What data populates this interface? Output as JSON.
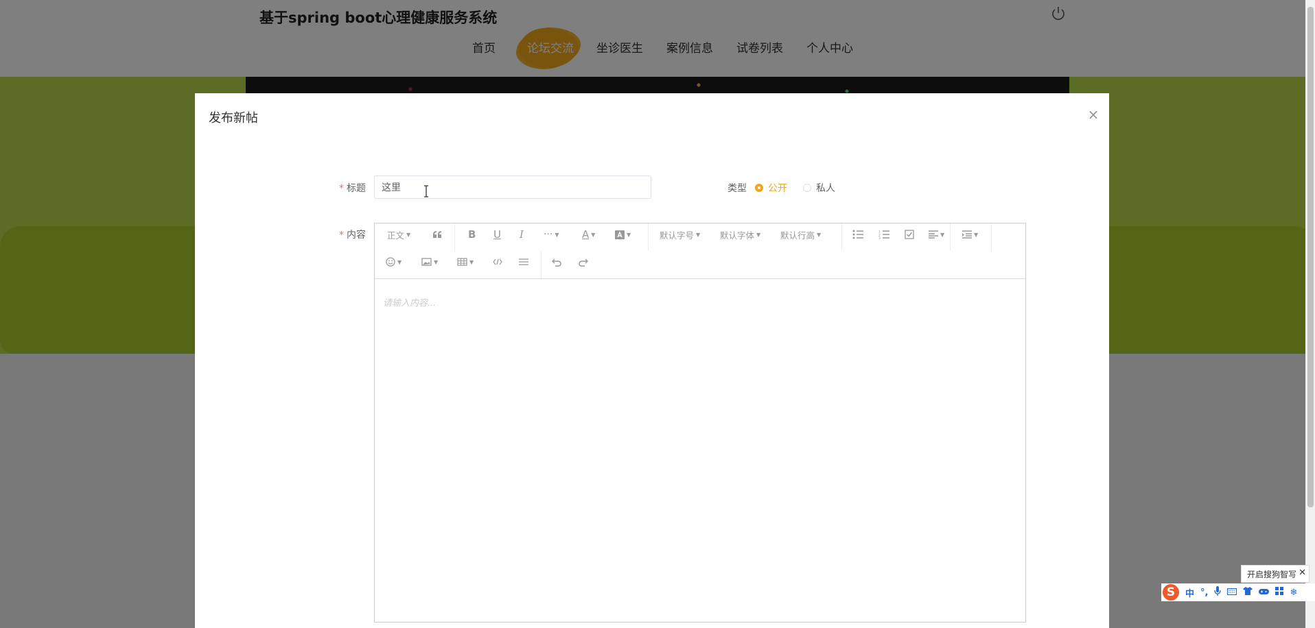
{
  "site": {
    "title": "基于spring boot心理健康服务系统"
  },
  "nav": {
    "items": [
      {
        "label": "首页"
      },
      {
        "label": "论坛交流",
        "active": true
      },
      {
        "label": "坐诊医生"
      },
      {
        "label": "案例信息"
      },
      {
        "label": "试卷列表"
      },
      {
        "label": "个人中心"
      }
    ]
  },
  "dialog": {
    "title": "发布新帖",
    "close_icon": "close-icon",
    "form": {
      "title_label": "标题",
      "title_value": "这里",
      "type_label": "类型",
      "type_options": [
        "公开",
        "私人"
      ],
      "type_selected": "公开",
      "content_label": "内容",
      "required_mark": "*"
    },
    "editor": {
      "toolbar": {
        "paragraph": "正文",
        "font_size": "默认字号",
        "font_family": "默认字体",
        "line_height": "默认行高"
      },
      "placeholder": "请输入内容..."
    }
  },
  "ime": {
    "tip": "开启搜狗智写",
    "logo": "S",
    "mode": "中",
    "punct": "°,"
  },
  "colors": {
    "accent": "#f0a818",
    "required": "#f56c6c",
    "green": "#b6d94a"
  }
}
